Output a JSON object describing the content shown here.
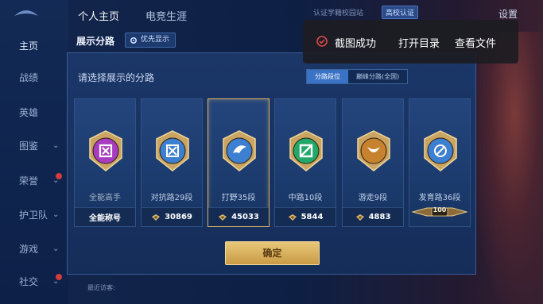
{
  "background": {
    "sidebar": [
      {
        "label": "主页",
        "active": true
      },
      {
        "label": "战绩"
      },
      {
        "label": "英雄"
      },
      {
        "label": "图鉴",
        "chevron": true
      },
      {
        "label": "荣誉",
        "chevron": true,
        "dot": true
      },
      {
        "label": "护卫队",
        "chevron": true
      },
      {
        "label": "游戏",
        "chevron": true
      },
      {
        "label": "社交",
        "chevron": true,
        "dot": true
      }
    ],
    "top_tabs": [
      "个人主页",
      "电竞生涯"
    ],
    "top_note": "认证学籍校园站",
    "top_badge": "高校认证",
    "top_right": "设置",
    "bottom_left": "最近访客:"
  },
  "dialog": {
    "title": "展示分路",
    "priority_label": "优先显示",
    "prompt": "请选择展示的分路",
    "segments": [
      {
        "label": "分路段位",
        "active": true
      },
      {
        "label": "巅峰分路(全国)",
        "active": false
      }
    ],
    "cards": [
      {
        "name": "全能高手",
        "footer": "全能称号",
        "has_coin": false,
        "selected": false,
        "emblem": "all-round",
        "color": "#a83cc0"
      },
      {
        "name": "对抗路29段",
        "footer": "30869",
        "has_coin": true,
        "selected": false,
        "emblem": "clash-lane",
        "color": "#3d7fd0"
      },
      {
        "name": "打野35段",
        "footer": "45033",
        "has_coin": true,
        "selected": true,
        "emblem": "jungle",
        "color": "#3d7fd0"
      },
      {
        "name": "中路10段",
        "footer": "5844",
        "has_coin": true,
        "selected": false,
        "emblem": "mid-lane",
        "color": "#23a86a"
      },
      {
        "name": "游走9段",
        "footer": "4883",
        "has_coin": true,
        "selected": false,
        "emblem": "roam",
        "color": "#c7822f"
      },
      {
        "name": "发育路36段",
        "footer": "",
        "has_coin": false,
        "selected": false,
        "emblem": "farm-lane",
        "color": "#3d7fd0",
        "level_badge": "100"
      }
    ],
    "confirm_label": "确定"
  },
  "toast": {
    "message": "截图成功",
    "open_dir": "打开目录",
    "view_file": "查看文件"
  }
}
